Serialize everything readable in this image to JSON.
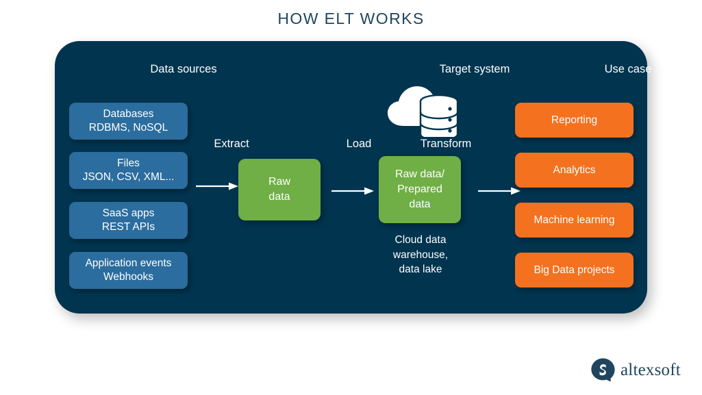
{
  "title": "HOW ELT WORKS",
  "columns": {
    "data_sources": "Data sources",
    "target_system": "Target system",
    "use_case": "Use case"
  },
  "sources": [
    {
      "line1": "Databases",
      "line2": "RDBMS, NoSQL"
    },
    {
      "line1": "Files",
      "line2": "JSON, CSV, XML..."
    },
    {
      "line1": "SaaS apps",
      "line2": "REST APIs"
    },
    {
      "line1": "Application events",
      "line2": "Webhooks"
    }
  ],
  "stages": {
    "extract": "Extract",
    "load": "Load",
    "transform": "Transform"
  },
  "process": {
    "raw": {
      "line1": "Raw",
      "line2": "data"
    },
    "prepared": {
      "line1": "Raw data/",
      "line2": "Prepared",
      "line3": "data"
    }
  },
  "target_caption": {
    "line1": "Cloud data",
    "line2": "warehouse,",
    "line3": "data lake"
  },
  "use_cases": [
    "Reporting",
    "Analytics",
    "Machine learning",
    "Big Data projects"
  ],
  "icons": {
    "target": "cloud-database-icon",
    "arrow": "right-arrow-icon",
    "logo_mark": "altexsoft-logo-mark"
  },
  "brand": {
    "name": "altexsoft"
  },
  "colors": {
    "panel_background": "#00344f",
    "source_box": "#2b6d9e",
    "process_box": "#6faf46",
    "usecase_box": "#f4711f",
    "title_text": "#20455e",
    "page_background": "#ffffff",
    "text_on_dark": "#ffffff"
  }
}
